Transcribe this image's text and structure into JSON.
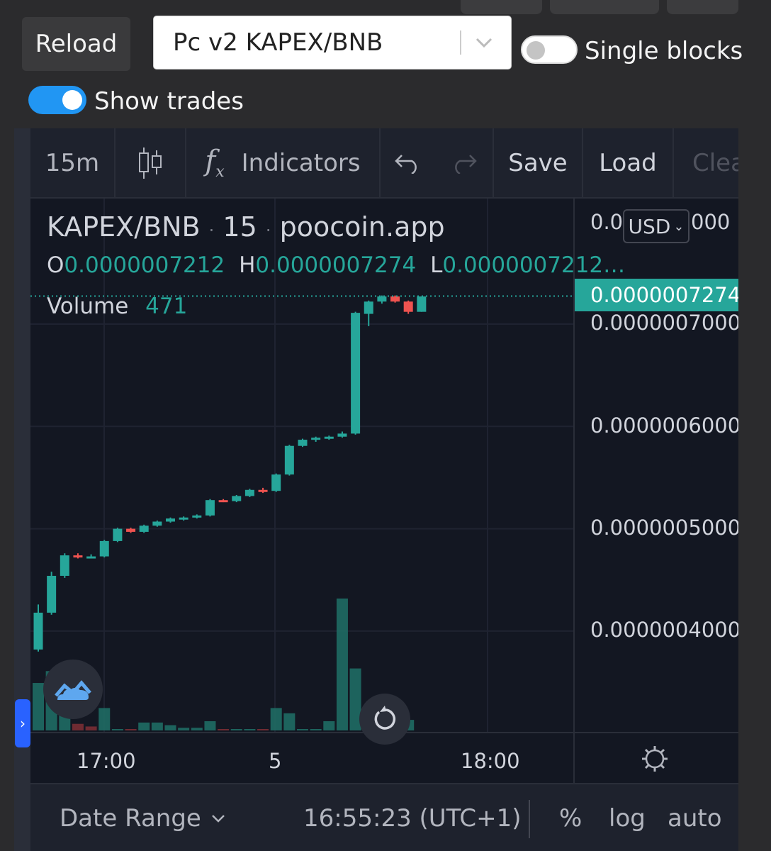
{
  "controls": {
    "reload_label": "Reload",
    "pair_select_value": "Pc v2 KAPEX/BNB",
    "single_blocks_label": "Single blocks",
    "single_blocks_on": false,
    "show_trades_label": "Show trades",
    "show_trades_on": true
  },
  "toolbar": {
    "interval": "15m",
    "indicators_label": "Indicators",
    "save_label": "Save",
    "load_label": "Load",
    "clear_label": "Clea"
  },
  "legend": {
    "symbol": "KAPEX/BNB",
    "interval": "15",
    "source": "poocoin.app",
    "sep": "·",
    "o_label": "O",
    "o_value": "0.0000007212",
    "h_label": "H",
    "h_value": "0.0000007274",
    "l_label": "L",
    "l_value": "0.0000007212…",
    "volume_label": "Volume",
    "volume_value": "471"
  },
  "price_scale": {
    "currency": "USD",
    "top_partial_left": "0.0(",
    "top_partial_right": "000",
    "last_price": "0.0000007274",
    "labels": [
      "0.0000007000",
      "0.0000006000",
      "0.0000005000",
      "0.0000004000"
    ]
  },
  "time_scale": {
    "labels": [
      "17:00",
      "5",
      "18:00"
    ]
  },
  "bottom_bar": {
    "date_range": "Date Range",
    "time": "16:55:23 (UTC+1)",
    "percent": "%",
    "log": "log",
    "auto": "auto"
  },
  "colors": {
    "up": "#26a69a",
    "down": "#ef5350",
    "background": "#131722",
    "toggle_on": "#2196f3"
  },
  "chart_data": {
    "type": "candlestick",
    "title": "KAPEX/BNB · 15 · poocoin.app",
    "xlabel": "",
    "ylabel": "",
    "ylim": [
      3.3e-07,
      7.8e-07
    ],
    "time_ticks": [
      "17:00",
      "5",
      "18:00"
    ],
    "candles": [
      {
        "o": 3.82e-07,
        "h": 4.26e-07,
        "l": 3.8e-07,
        "c": 4.18e-07
      },
      {
        "o": 4.18e-07,
        "h": 4.58e-07,
        "l": 4.16e-07,
        "c": 4.54e-07
      },
      {
        "o": 4.54e-07,
        "h": 4.76e-07,
        "l": 4.52e-07,
        "c": 4.74e-07
      },
      {
        "o": 4.74e-07,
        "h": 4.76e-07,
        "l": 4.71e-07,
        "c": 4.72e-07
      },
      {
        "o": 4.72e-07,
        "h": 4.75e-07,
        "l": 4.71e-07,
        "c": 4.73e-07
      },
      {
        "o": 4.73e-07,
        "h": 4.89e-07,
        "l": 4.72e-07,
        "c": 4.88e-07
      },
      {
        "o": 4.88e-07,
        "h": 5.01e-07,
        "l": 4.87e-07,
        "c": 5e-07
      },
      {
        "o": 5e-07,
        "h": 5.01e-07,
        "l": 4.96e-07,
        "c": 4.97e-07
      },
      {
        "o": 4.97e-07,
        "h": 5.04e-07,
        "l": 4.96e-07,
        "c": 5.03e-07
      },
      {
        "o": 5.03e-07,
        "h": 5.08e-07,
        "l": 5.02e-07,
        "c": 5.07e-07
      },
      {
        "o": 5.07e-07,
        "h": 5.11e-07,
        "l": 5.06e-07,
        "c": 5.1e-07
      },
      {
        "o": 5.1e-07,
        "h": 5.12e-07,
        "l": 5.08e-07,
        "c": 5.11e-07
      },
      {
        "o": 5.11e-07,
        "h": 5.14e-07,
        "l": 5.1e-07,
        "c": 5.13e-07
      },
      {
        "o": 5.13e-07,
        "h": 5.29e-07,
        "l": 5.12e-07,
        "c": 5.28e-07
      },
      {
        "o": 5.28e-07,
        "h": 5.29e-07,
        "l": 5.26e-07,
        "c": 5.27e-07
      },
      {
        "o": 5.27e-07,
        "h": 5.33e-07,
        "l": 5.26e-07,
        "c": 5.32e-07
      },
      {
        "o": 5.32e-07,
        "h": 5.39e-07,
        "l": 5.31e-07,
        "c": 5.38e-07
      },
      {
        "o": 5.38e-07,
        "h": 5.4e-07,
        "l": 5.35e-07,
        "c": 5.37e-07
      },
      {
        "o": 5.37e-07,
        "h": 5.54e-07,
        "l": 5.36e-07,
        "c": 5.53e-07
      },
      {
        "o": 5.53e-07,
        "h": 5.82e-07,
        "l": 5.52e-07,
        "c": 5.81e-07
      },
      {
        "o": 5.81e-07,
        "h": 5.88e-07,
        "l": 5.8e-07,
        "c": 5.87e-07
      },
      {
        "o": 5.87e-07,
        "h": 5.9e-07,
        "l": 5.85e-07,
        "c": 5.89e-07
      },
      {
        "o": 5.89e-07,
        "h": 5.91e-07,
        "l": 5.87e-07,
        "c": 5.9e-07
      },
      {
        "o": 5.9e-07,
        "h": 5.95e-07,
        "l": 5.89e-07,
        "c": 5.93e-07
      },
      {
        "o": 5.93e-07,
        "h": 7.12e-07,
        "l": 5.92e-07,
        "c": 7.11e-07
      },
      {
        "o": 7.1e-07,
        "h": 7.23e-07,
        "l": 6.98e-07,
        "c": 7.22e-07
      },
      {
        "o": 7.22e-07,
        "h": 7.28e-07,
        "l": 7.2e-07,
        "c": 7.27e-07
      },
      {
        "o": 7.27e-07,
        "h": 7.28e-07,
        "l": 7.21e-07,
        "c": 7.22e-07
      },
      {
        "o": 7.22e-07,
        "h": 7.23e-07,
        "l": 7.1e-07,
        "c": 7.12e-07
      },
      {
        "o": 7.12e-07,
        "h": 7.27e-07,
        "l": 7.12e-07,
        "c": 7.27e-07
      }
    ],
    "volume": [
      {
        "v": 0.36,
        "up": true
      },
      {
        "v": 0.45,
        "up": true
      },
      {
        "v": 0.26,
        "up": true
      },
      {
        "v": 0.05,
        "up": false
      },
      {
        "v": 0.03,
        "up": false
      },
      {
        "v": 0.17,
        "up": true
      },
      {
        "v": 0.01,
        "up": true
      },
      {
        "v": 0.01,
        "up": false
      },
      {
        "v": 0.06,
        "up": true
      },
      {
        "v": 0.06,
        "up": true
      },
      {
        "v": 0.04,
        "up": true
      },
      {
        "v": 0.02,
        "up": true
      },
      {
        "v": 0.02,
        "up": true
      },
      {
        "v": 0.07,
        "up": true
      },
      {
        "v": 0.01,
        "up": false
      },
      {
        "v": 0.01,
        "up": true
      },
      {
        "v": 0.01,
        "up": true
      },
      {
        "v": 0.01,
        "up": false
      },
      {
        "v": 0.17,
        "up": true
      },
      {
        "v": 0.13,
        "up": true
      },
      {
        "v": 0.01,
        "up": true
      },
      {
        "v": 0.01,
        "up": true
      },
      {
        "v": 0.07,
        "up": true
      },
      {
        "v": 1.0,
        "up": true
      },
      {
        "v": 0.47,
        "up": true
      },
      {
        "v": 0.07,
        "up": true
      },
      {
        "v": 0.05,
        "up": false
      },
      {
        "v": 0.01,
        "up": false
      },
      {
        "v": 0.08,
        "up": true
      }
    ]
  }
}
